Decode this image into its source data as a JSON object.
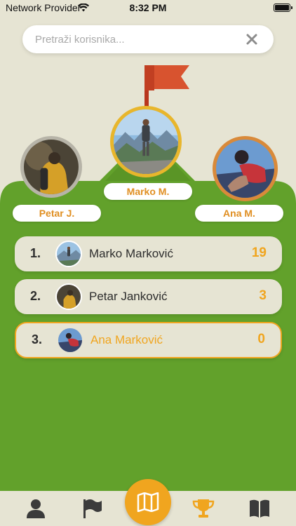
{
  "status_bar": {
    "carrier": "Network Provider",
    "time": "8:32 PM"
  },
  "search": {
    "placeholder": "Pretraži korisnika...",
    "value": ""
  },
  "podium": {
    "first": {
      "label": "Marko M."
    },
    "second": {
      "label": "Petar J."
    },
    "third": {
      "label": "Ana M."
    }
  },
  "leaderboard": [
    {
      "rank": "1.",
      "name": "Marko Marković",
      "points": "19"
    },
    {
      "rank": "2.",
      "name": "Petar Janković",
      "points": "3"
    },
    {
      "rank": "3.",
      "name": "Ana Marković",
      "points": "0"
    }
  ],
  "tabbar": {
    "items": [
      {
        "icon": "user-icon",
        "active": false
      },
      {
        "icon": "flag-icon",
        "active": false
      },
      {
        "icon": "map-icon",
        "active": false
      },
      {
        "icon": "trophy-icon",
        "active": true
      },
      {
        "icon": "book-icon",
        "active": false
      }
    ]
  },
  "colors": {
    "background": "#e6e4d3",
    "field_green": "#62a12b",
    "accent_orange": "#f0a51f",
    "flag_red": "#d8532f",
    "dark_icon": "#3b3b3b"
  }
}
